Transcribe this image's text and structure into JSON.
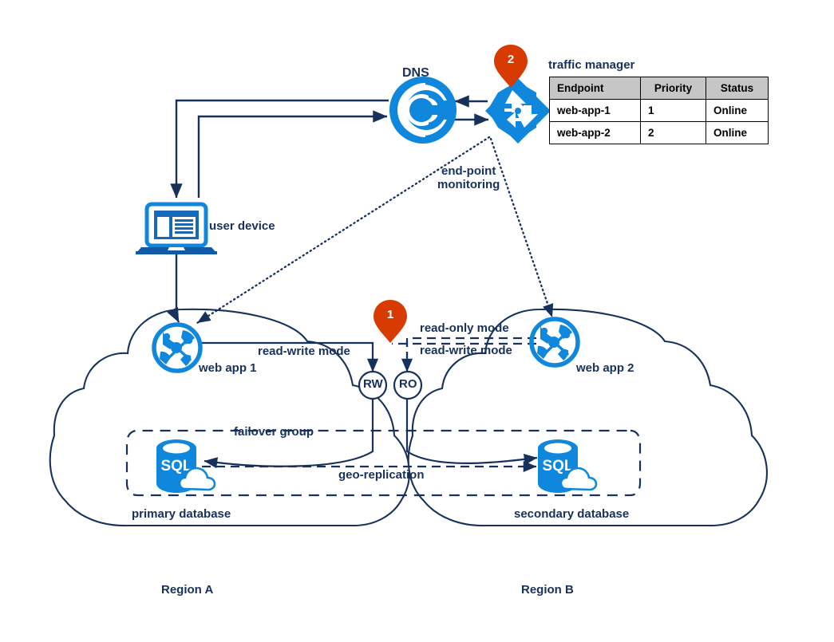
{
  "diagram": {
    "title": "Azure SQL failover group with Traffic Manager across two regions",
    "colors": {
      "dark_navy": "#17315c",
      "azure_blue": "#0f87dc",
      "orange_pin": "#d83b01",
      "table_header_gray": "#c6c6c6",
      "status_green": "#00b050"
    },
    "labels": {
      "dns": "DNS",
      "traffic_manager": "traffic manager",
      "user_device": "user device",
      "endpoint_monitoring_line1": "end-point",
      "endpoint_monitoring_line2": "monitoring",
      "web_app_1": "web app 1",
      "web_app_2": "web app 2",
      "read_write_mode": "read-write mode",
      "read_only_mode_right": "read-only mode",
      "read_write_mode_right": "read-write mode",
      "failover_group": "failover group",
      "geo_replication": "geo-replication",
      "primary_database": "primary database",
      "secondary_database": "secondary database",
      "region_a": "Region A",
      "region_b": "Region B"
    },
    "nodes": {
      "rw_listener": "RW",
      "ro_listener": "RO"
    },
    "pins": [
      {
        "number": "2",
        "attached_to": "traffic manager"
      },
      {
        "number": "1",
        "attached_to": "failover group listeners"
      }
    ],
    "icons": [
      {
        "name": "dns-icon",
        "label": "DNS"
      },
      {
        "name": "traffic-manager-icon",
        "label": "traffic manager"
      },
      {
        "name": "user-device-icon",
        "label": "user device"
      },
      {
        "name": "web-app-icon-1",
        "label": "web app 1"
      },
      {
        "name": "web-app-icon-2",
        "label": "web app 2"
      },
      {
        "name": "sql-database-icon-primary",
        "label": "primary database"
      },
      {
        "name": "sql-database-icon-secondary",
        "label": "secondary database"
      }
    ]
  },
  "traffic_manager_table": {
    "caption": "traffic manager",
    "columns": [
      "Endpoint",
      "Priority",
      "Status"
    ],
    "rows": [
      {
        "endpoint": "web-app-1",
        "priority": "1",
        "status": "Online",
        "status_highlighted": true
      },
      {
        "endpoint": "web-app-2",
        "priority": "2",
        "status": "Online",
        "status_highlighted": false
      }
    ]
  }
}
